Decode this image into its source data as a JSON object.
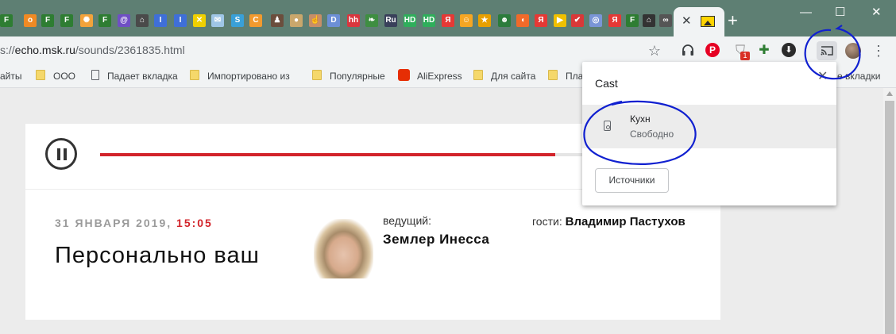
{
  "tabstrip": {
    "favicons": [
      {
        "icon": "f-icon",
        "glyph": "F",
        "bg": "#2e7d32"
      },
      {
        "icon": "o-icon",
        "glyph": "o",
        "bg": "#f08a24"
      },
      {
        "icon": "f-icon",
        "glyph": "F",
        "bg": "#2e7d32"
      },
      {
        "icon": "f-icon",
        "glyph": "F",
        "bg": "#2e7d32"
      },
      {
        "icon": "film-reel-icon",
        "glyph": "✺",
        "bg": "#f3a33b"
      },
      {
        "icon": "f-icon",
        "glyph": "F",
        "bg": "#2e7d32"
      },
      {
        "icon": "at-icon",
        "glyph": "@",
        "bg": "#6f4fc4"
      },
      {
        "icon": "home-icon",
        "glyph": "⌂",
        "bg": "#4a4a4a"
      },
      {
        "icon": "cursor-icon",
        "glyph": "I",
        "bg": "#3f6fd8"
      },
      {
        "icon": "cursor-icon",
        "glyph": "I",
        "bg": "#3f6fd8"
      },
      {
        "icon": "cross-icon",
        "glyph": "✕",
        "bg": "#f0d000"
      },
      {
        "icon": "mail-icon",
        "glyph": "✉",
        "bg": "#9fc6e7"
      },
      {
        "icon": "s-icon",
        "glyph": "S",
        "bg": "#39a0d8"
      },
      {
        "icon": "c-icon",
        "glyph": "C",
        "bg": "#f29a2e"
      },
      {
        "icon": "person-icon",
        "glyph": "♟",
        "bg": "#6b4e3d"
      },
      {
        "icon": "circle-icon",
        "glyph": "●",
        "bg": "#c9a76c"
      },
      {
        "icon": "finger-icon",
        "glyph": "☝",
        "bg": "#c78e67"
      },
      {
        "icon": "d-icon",
        "glyph": "D",
        "bg": "#6c8fd6"
      },
      {
        "icon": "hh-icon",
        "glyph": "hh",
        "bg": "#d9363e"
      },
      {
        "icon": "leaf-icon",
        "glyph": "❧",
        "bg": "#3e8e41"
      },
      {
        "icon": "ru-icon",
        "glyph": "Ru",
        "bg": "#39405a"
      },
      {
        "icon": "hd-icon",
        "glyph": "HD",
        "bg": "#2fae5b"
      },
      {
        "icon": "hd-icon",
        "glyph": "HD",
        "bg": "#2fae5b"
      },
      {
        "icon": "yandex-icon",
        "glyph": "Я",
        "bg": "#e53935"
      },
      {
        "icon": "smile-icon",
        "glyph": "☺",
        "bg": "#f5a623"
      },
      {
        "icon": "star-icon",
        "glyph": "★",
        "bg": "#e8a000"
      },
      {
        "icon": "face-icon",
        "glyph": "☻",
        "bg": "#2c7c3c"
      },
      {
        "icon": "speech-icon",
        "glyph": "◖",
        "bg": "#f06a2a"
      },
      {
        "icon": "yandex-icon",
        "glyph": "Я",
        "bg": "#e53935"
      },
      {
        "icon": "play-icon",
        "glyph": "▶",
        "bg": "#f0c000"
      },
      {
        "icon": "check-icon",
        "glyph": "✔",
        "bg": "#d93838"
      },
      {
        "icon": "bulb-icon",
        "glyph": "◎",
        "bg": "#7a95d6"
      },
      {
        "icon": "yandex-icon",
        "glyph": "Я",
        "bg": "#e53935"
      },
      {
        "icon": "f-icon",
        "glyph": "F",
        "bg": "#2e7d32"
      },
      {
        "icon": "home-icon",
        "glyph": "⌂",
        "bg": "#333333"
      },
      {
        "icon": "oo-icon",
        "glyph": "∞",
        "bg": "#555555"
      }
    ],
    "new_tab": "+",
    "minimize": "—",
    "maximize": "☐",
    "close": "✕",
    "active_tab_close": "✕"
  },
  "toolbar": {
    "url_prefix": "s://",
    "url_host": "echo.msk.ru",
    "url_path": "/sounds/2361835.html",
    "icons": [
      "star-icon",
      "headphones-icon",
      "pinterest-icon",
      "shield-icon",
      "puzzle-icon",
      "download-icon",
      "cast-icon",
      "avatar",
      "menu-icon"
    ],
    "star": "☆",
    "headphones": "🎧",
    "pinterest": "P",
    "shield": "⛉",
    "badge": "1",
    "colorful": "✚",
    "download": "⬇",
    "menu": "⋮"
  },
  "bookmarks": {
    "items": [
      {
        "label": "айты"
      },
      {
        "label": "ООО"
      },
      {
        "label": "Падает вкладка"
      },
      {
        "label": "Импортировано из"
      },
      {
        "label": "Популярные"
      },
      {
        "label": "AliExpress"
      },
      {
        "label": "Для сайта"
      },
      {
        "label": "Пла"
      }
    ],
    "other": "е вкладки"
  },
  "player": {
    "progress": 0.94,
    "date": "31 ЯНВАРЯ 2019, ",
    "time": "15:05",
    "title": "Персонально ваш",
    "host_label": "ведущий:",
    "host_name": "Землер Инесса",
    "guests_label": "гости: ",
    "guest_name": "Владимир Пастухов"
  },
  "cast_popup": {
    "title": "Cast",
    "close": "✕",
    "sink_name": "Кухн",
    "sink_status": "Свободно",
    "sources_button": "Источники"
  }
}
